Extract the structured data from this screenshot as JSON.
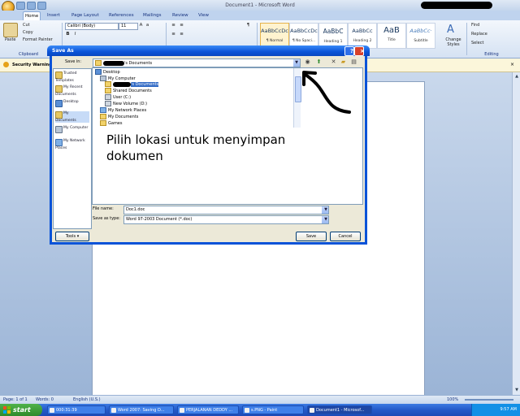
{
  "word": {
    "window_title": "Document1 - Microsoft Word",
    "tabs": [
      "Home",
      "Insert",
      "Page Layout",
      "References",
      "Mailings",
      "Review",
      "View"
    ],
    "clipboard": {
      "paste": "Paste",
      "cut": "Cut",
      "copy": "Copy",
      "format_painter": "Format Painter",
      "group": "Clipboard"
    },
    "font": {
      "name": "Calibri (Body)",
      "size": "11",
      "bold": "B",
      "italic": "I"
    },
    "styles": [
      {
        "preview": "AaBbCcDc",
        "name": "¶ Normal"
      },
      {
        "preview": "AaBbCcDc",
        "name": "¶ No Spaci..."
      },
      {
        "preview": "AaBbC",
        "name": "Heading 1"
      },
      {
        "preview": "AaBbCc",
        "name": "Heading 2"
      },
      {
        "preview": "AaB",
        "name": "Title"
      },
      {
        "preview": "AaBbCc·",
        "name": "Subtitle"
      }
    ],
    "change_styles": "Change Styles",
    "editing": {
      "find": "Find",
      "replace": "Replace",
      "select": "Select",
      "group": "Editing"
    },
    "security_warning": "Security Warning",
    "status": {
      "page": "Page: 1 of 1",
      "words": "Words: 0",
      "language": "English (U.S.)",
      "zoom": "100%"
    }
  },
  "dialog": {
    "title": "Save As",
    "help": "?",
    "close": "×",
    "save_in_label": "Save in:",
    "save_in_value": "'s Documents",
    "places": [
      "Trusted Templates",
      "My Recent Documents",
      "Desktop",
      "My Documents",
      "My Computer",
      "My Network Places"
    ],
    "tree": [
      {
        "label": "Desktop",
        "indent": 0
      },
      {
        "label": "My Computer",
        "indent": 1
      },
      {
        "label": "'s Documents",
        "indent": 2,
        "selected": true,
        "redacted": true
      },
      {
        "label": "Shared Documents",
        "indent": 2
      },
      {
        "label": "User (C:)",
        "indent": 2
      },
      {
        "label": "New Volume (D:)",
        "indent": 2
      },
      {
        "label": "My Network Places",
        "indent": 1
      },
      {
        "label": "My Documents",
        "indent": 1
      },
      {
        "label": "Games",
        "indent": 1
      }
    ],
    "annotation": "Pilih lokasi untuk menyimpan dokumen",
    "file_name_label": "File name:",
    "file_name_value": "Doc1.doc",
    "save_type_label": "Save as type:",
    "save_type_value": "Word 97-2003 Document (*.doc)",
    "tools": "Tools",
    "save": "Save",
    "cancel": "Cancel"
  },
  "taskbar": {
    "start": "start",
    "buttons": [
      "000:31:39",
      "Word 2007: Saving D...",
      "PERJALANAN DEDDY ...",
      "s.PNG - Paint",
      "Document1 - Microsof..."
    ],
    "clock": "9:57 AM"
  },
  "colors": {
    "dialog_blue": "#0a53d8",
    "taskbar_blue": "#245ac9",
    "start_green": "#3a9a35"
  }
}
